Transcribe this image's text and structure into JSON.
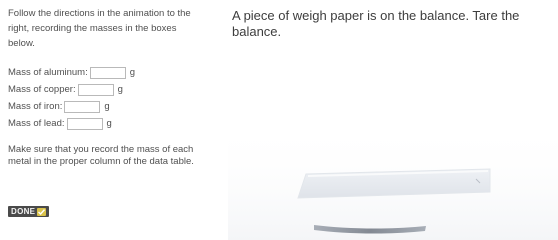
{
  "instructions": {
    "text": "Follow the directions in the animation to the right, recording the masses in the boxes below."
  },
  "mass_fields": [
    {
      "label": "Mass of aluminum:",
      "value": "",
      "unit": "g"
    },
    {
      "label": "Mass of copper:",
      "value": "",
      "unit": "g"
    },
    {
      "label": "Mass of iron:",
      "value": "",
      "unit": "g"
    },
    {
      "label": "Mass of lead:",
      "value": "",
      "unit": "g"
    }
  ],
  "note": {
    "text": "Make sure that you record the mass of each metal in the proper column of the data table."
  },
  "done_button": {
    "label": "DONE"
  },
  "animation": {
    "instruction": "A piece of weigh paper is on the balance. Tare the balance."
  }
}
